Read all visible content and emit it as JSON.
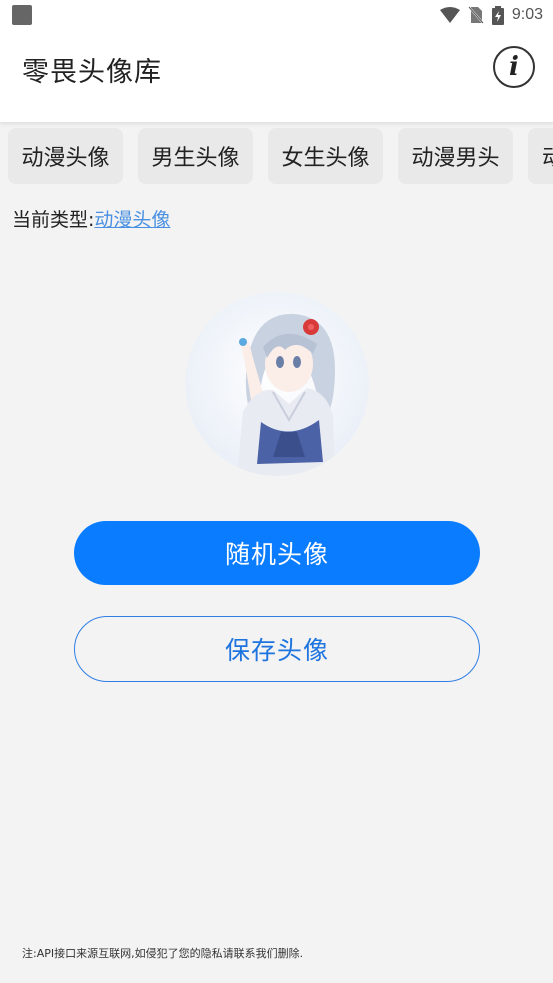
{
  "status": {
    "time": "9:03",
    "icons": [
      "app-notification-icon",
      "wifi-icon",
      "no-sim-icon",
      "battery-charging-icon"
    ]
  },
  "appbar": {
    "title": "零畏头像库",
    "info_icon": "info-icon"
  },
  "categories": [
    "动漫头像",
    "男生头像",
    "女生头像",
    "动漫男头",
    "动"
  ],
  "current": {
    "label": "当前类型:",
    "value": "动漫头像"
  },
  "avatar": {
    "description_icon": "anime-avatar-image"
  },
  "buttons": {
    "random": "随机头像",
    "save": "保存头像"
  },
  "footer": {
    "note": "注:API接口来源互联网,如侵犯了您的隐私请联系我们删除."
  },
  "colors": {
    "primary": "#0a7cff",
    "link": "#4a90e2",
    "background": "#f3f3f3"
  }
}
